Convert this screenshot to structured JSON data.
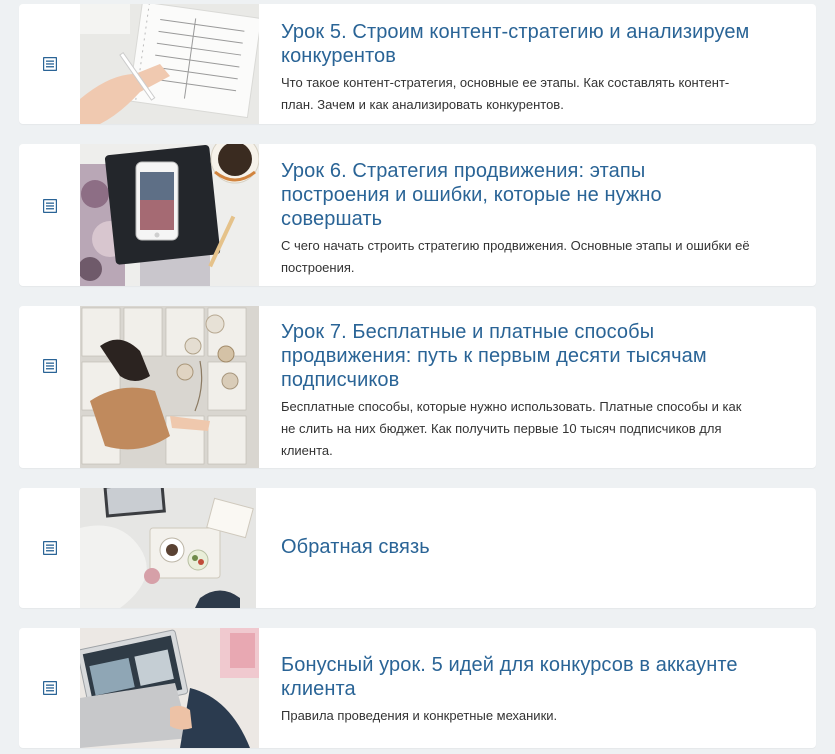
{
  "accent_color": "#2a6496",
  "background_color": "#eef1f3",
  "lessons": [
    {
      "icon": "lesson-text-icon",
      "title": "Урок 5. Строим контент-стратегию и анализируем конкурентов",
      "description": "Что такое контент-стратегия, основные ее этапы. Как составлять контент-план. Зачем и как анализировать конкурентов.",
      "thumbnail": "notebook-planner-photo"
    },
    {
      "icon": "lesson-text-icon",
      "title": "Урок 6. Стратегия продвижения: этапы построения и ошибки, которые не нужно совершать",
      "description": "С чего начать строить стратегию продвижения. Основные этапы и ошибки её построения.",
      "thumbnail": "phone-notebook-coffee-photo"
    },
    {
      "icon": "lesson-text-icon",
      "title": "Урок 7. Бесплатные и платные способы продвижения: путь к первым десяти тысячам подписчиков",
      "description": "Бесплатные способы, которые нужно использовать. Платные способы и как не слить на них бюджет. Как получить первые 10 тысяч подписчиков для клиента.",
      "thumbnail": "books-girl-photo"
    },
    {
      "icon": "lesson-text-icon",
      "title": "Обратная связь",
      "description": "",
      "thumbnail": "laptop-breakfast-tray-photo"
    },
    {
      "icon": "lesson-text-icon",
      "title": "Бонусный урок. 5 идей для конкурсов в аккаунте клиента",
      "description": "Правила проведения и конкретные механики.",
      "thumbnail": "laptop-on-lap-photo"
    }
  ]
}
